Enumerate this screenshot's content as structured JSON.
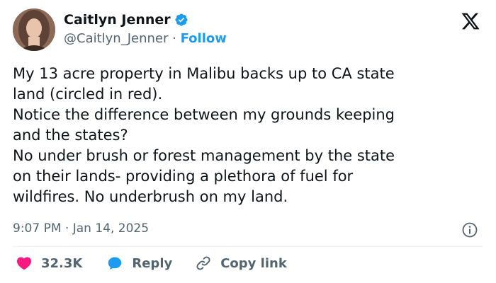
{
  "author": {
    "name": "Caitlyn Jenner",
    "handle": "@Caitlyn_Jenner",
    "separator": "·",
    "follow_label": "Follow",
    "verified_icon": "verified-badge-icon"
  },
  "brand_logo": "x-logo-icon",
  "tweet": {
    "lines": [
      "My 13 acre property in Malibu backs up to CA state",
      "land (circled in red).",
      "Notice the difference between my grounds keeping",
      "and the states?",
      "No under brush or forest management by the state",
      "on their lands- providing a plethora of fuel for",
      "wildfires. No underbrush on my land."
    ],
    "timestamp": "9:07 PM · Jan 14, 2025"
  },
  "actions": {
    "like_count": "32.3K",
    "reply_label": "Reply",
    "copy_link_label": "Copy link"
  },
  "colors": {
    "accent": "#1d9bf0",
    "like": "#f91880",
    "text": "#0f1419",
    "muted": "#536471"
  }
}
